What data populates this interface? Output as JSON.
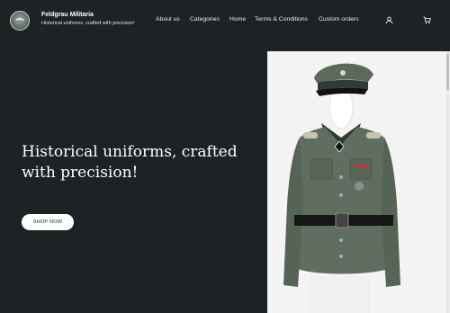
{
  "brand": {
    "name": "Feldgrau Militaria",
    "tagline": "Historical uniforms, crafted with precision!"
  },
  "nav": {
    "items": [
      {
        "label": "About us"
      },
      {
        "label": "Categories"
      },
      {
        "label": "Home"
      },
      {
        "label": "Terms & Conditions"
      },
      {
        "label": "Custom orders"
      }
    ]
  },
  "icons": {
    "account": "account-icon",
    "cart": "cart-icon"
  },
  "hero": {
    "title": "Historical uniforms, crafted with precision!",
    "button_label": "SHOP NOW"
  },
  "colors": {
    "background": "#1d2224",
    "uniform": "#5f6d60",
    "button": "#ffffff"
  }
}
